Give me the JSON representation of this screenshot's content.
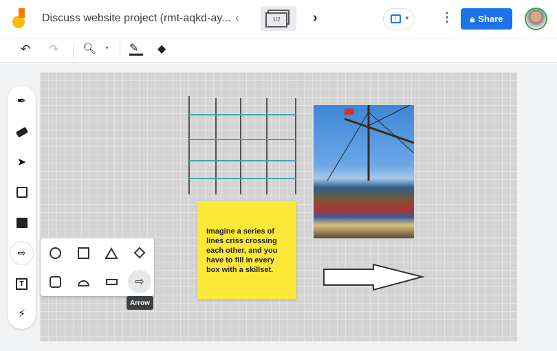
{
  "header": {
    "title": "Discuss website project (rmt-aqkd-ay...",
    "frame_indicator": "1/2",
    "share_label": "Share"
  },
  "sticky_note": {
    "text": "Imagine a series of lines criss crossing each other, and you have to fill in every box with a skillset."
  },
  "tooltip": "Arrow",
  "colors": {
    "accent": "#1a73e8",
    "sticky": "#fde837",
    "canvas": "#d4d4d4"
  }
}
